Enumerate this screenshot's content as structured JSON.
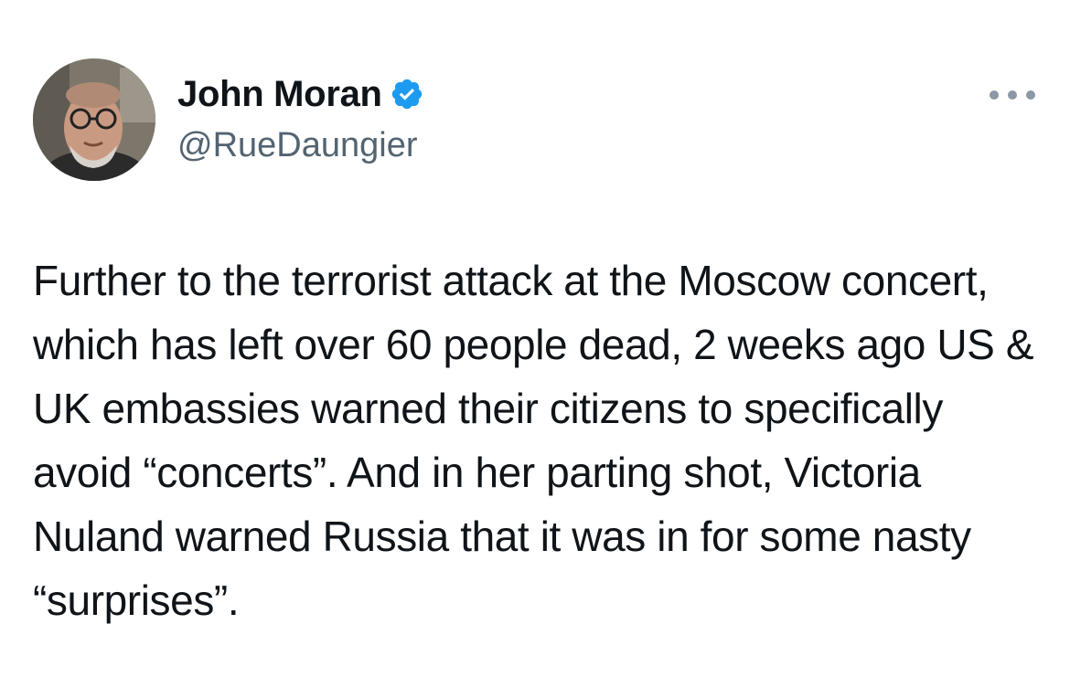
{
  "author": {
    "display_name": "John Moran",
    "handle": "@RueDaungier",
    "verified": true
  },
  "icons": {
    "verified": "verified-badge-icon",
    "more": "more-options-icon"
  },
  "tweet": {
    "text": "Further to the terrorist attack at the Moscow concert, which has left over 60 people dead, 2 weeks ago US & UK embassies warned their citizens to specifically avoid “concerts”. And in her parting shot, Victoria Nuland warned Russia that it was in for some nasty “surprises”."
  },
  "colors": {
    "verified_blue": "#1d9bf0",
    "handle_gray": "#536471",
    "text": "#0f1419"
  }
}
